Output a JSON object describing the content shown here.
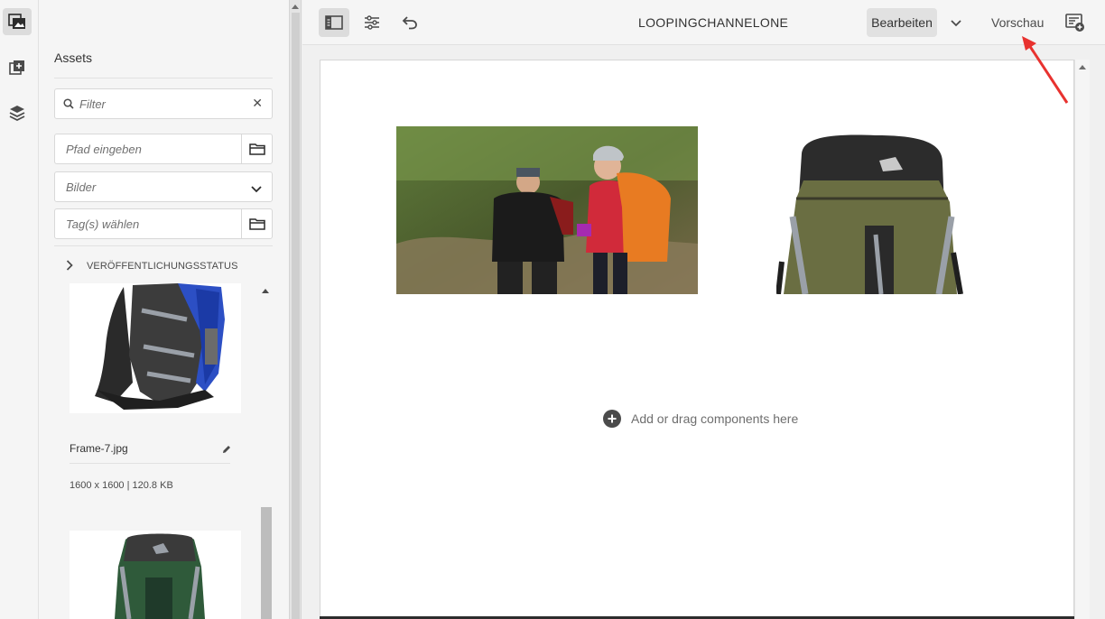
{
  "rail": {
    "items": [
      {
        "name": "asset-finder",
        "active": true
      },
      {
        "name": "components",
        "active": false
      },
      {
        "name": "content-tree",
        "active": false
      }
    ]
  },
  "panel": {
    "title": "Assets",
    "filter": {
      "placeholder": "Filter",
      "clear": "✕"
    },
    "path": {
      "placeholder": "Pfad eingeben"
    },
    "type": {
      "value": "Bilder"
    },
    "tags": {
      "placeholder": "Tag(s) wählen"
    },
    "status_section": "VERÖFFENTLICHUNGSSTATUS",
    "assets": [
      {
        "name": "Frame-7.jpg",
        "meta": "1600 x 1600 | 120.8 KB"
      },
      {
        "name": "",
        "meta": ""
      }
    ]
  },
  "toolbar": {
    "page_title": "LOOPINGCHANNELONE",
    "mode_label": "Bearbeiten",
    "preview_label": "Vorschau"
  },
  "canvas": {
    "placeholder": "Add or drag components here"
  },
  "colors": {
    "accent_arrow": "#e8322f",
    "rail_bg": "#f5f5f5",
    "canvas_bg": "#ffffff"
  }
}
